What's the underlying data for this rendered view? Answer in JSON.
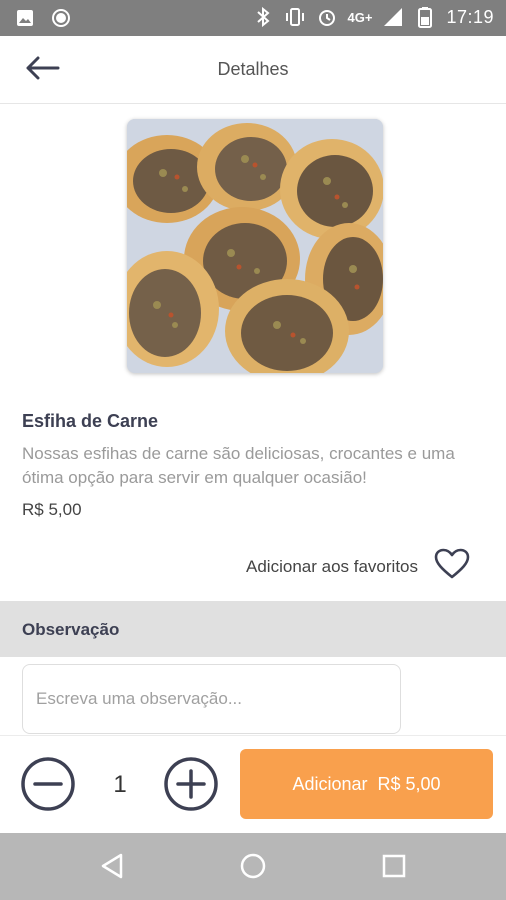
{
  "status_bar": {
    "network": "4G+",
    "time": "17:19",
    "icons": [
      "image-icon",
      "circle-icon",
      "bluetooth-icon",
      "vibrate-icon",
      "alarm-icon",
      "signal-icon",
      "battery-icon"
    ]
  },
  "header": {
    "title": "Detalhes",
    "back_icon": "arrow-left-icon"
  },
  "product": {
    "image_description": "esfiha",
    "name": "Esfiha de Carne",
    "description": "Nossas esfihas de carne são deliciosas, crocantes e uma ótima opção para servir em qualquer ocasião!",
    "price": "R$ 5,00"
  },
  "favorite": {
    "label": "Adicionar aos favoritos",
    "icon": "heart-outline-icon",
    "checked": false
  },
  "observation": {
    "title": "Observação",
    "value": "",
    "placeholder": "Escreva uma observação..."
  },
  "cart": {
    "quantity": "1",
    "minus_icon": "minus-circle-icon",
    "plus_icon": "plus-circle-icon",
    "add_label": "Adicionar",
    "add_price": "R$ 5,00"
  },
  "nav_bar": {
    "icons": [
      "triangle-back-icon",
      "circle-home-icon",
      "square-recent-icon"
    ]
  },
  "colors": {
    "accent": "#f9a04d",
    "dark_text": "#3d4053",
    "muted_text": "#9a9a9a",
    "status_bar": "#7f7f7f",
    "nav_bar": "#b7b7b7",
    "section_bg": "#e0e0e0"
  }
}
